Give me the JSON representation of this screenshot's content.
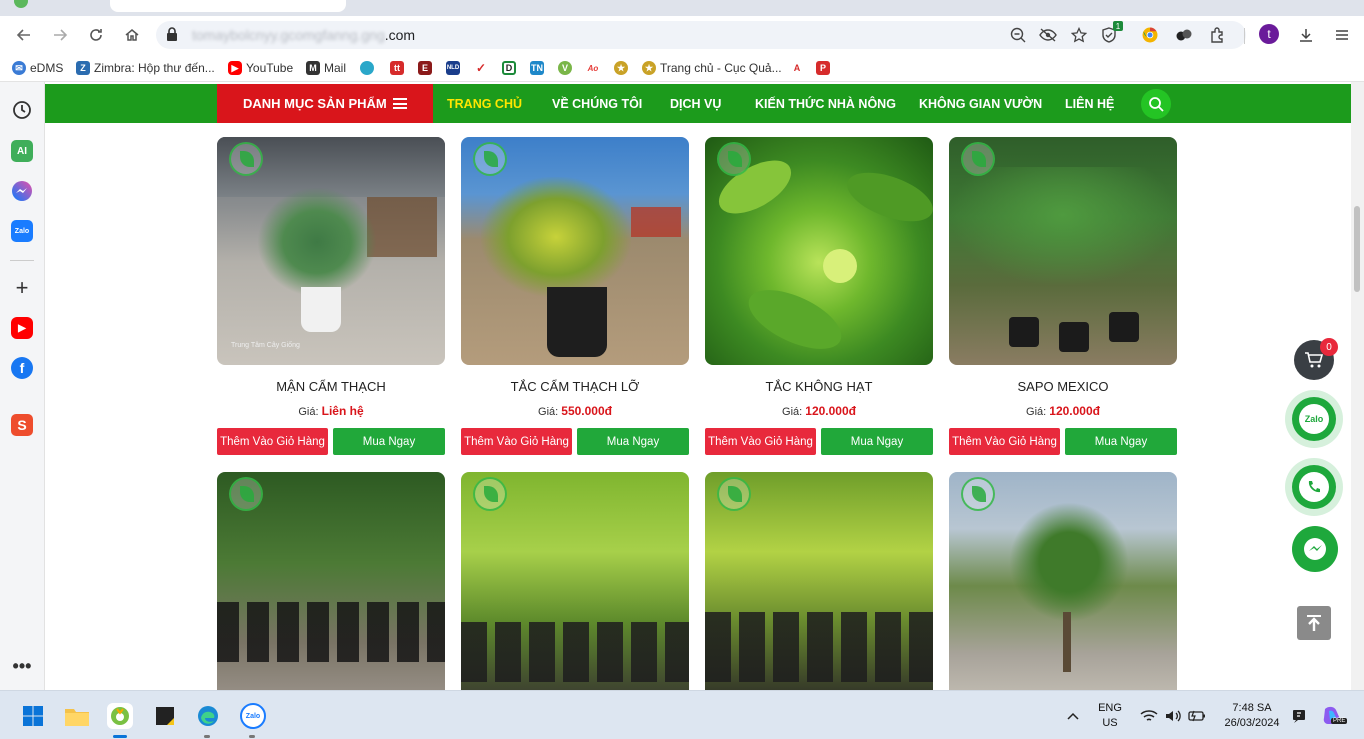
{
  "browser": {
    "url_host": "tomaybolcnyy.gcomgfanng.gng",
    "url_suffix": ".com",
    "extension_badge": "1",
    "profile_initial": "t"
  },
  "bookmarks": [
    {
      "label": "eDMS",
      "icon": "edms-icon",
      "color": "#3a7bd5"
    },
    {
      "label": "Zimbra: Hộp thư đến...",
      "icon": "zimbra-icon",
      "color": "#2b6cb0"
    },
    {
      "label": "YouTube",
      "icon": "youtube-icon",
      "color": "#ff0000"
    },
    {
      "label": "Mail",
      "icon": "mail-icon",
      "color": "#333333"
    },
    {
      "label": "",
      "icon": "bookmark-globe-icon",
      "color": "#2aa7c9"
    },
    {
      "label": "",
      "icon": "bookmark-tt-icon",
      "color": "#d62b2b"
    },
    {
      "label": "",
      "icon": "bookmark-e-icon",
      "color": "#8b1a1a"
    },
    {
      "label": "",
      "icon": "bookmark-nld-icon",
      "color": "#1a3d8b"
    },
    {
      "label": "",
      "icon": "bookmark-check-icon",
      "color": "#d62b2b"
    },
    {
      "label": "",
      "icon": "bookmark-d-icon",
      "color": "#222222"
    },
    {
      "label": "",
      "icon": "bookmark-tn-icon",
      "color": "#1e88c9"
    },
    {
      "label": "",
      "icon": "bookmark-v-icon",
      "color": "#7ab648"
    },
    {
      "label": "",
      "icon": "bookmark-ao-icon",
      "color": "#e53935"
    },
    {
      "label": "",
      "icon": "bookmark-emblem-icon",
      "color": "#c9a227"
    },
    {
      "label": "Trang chủ - Cục Quả...",
      "icon": "emblem-icon",
      "color": "#c9a227"
    },
    {
      "label": "",
      "icon": "bookmark-a-icon",
      "color": "#d62b2b"
    },
    {
      "label": "",
      "icon": "bookmark-p-icon",
      "color": "#d62b2b"
    }
  ],
  "site_nav": {
    "category_menu": "DANH MỤC SẢN PHẨM",
    "items": [
      "TRANG CHỦ",
      "VỀ CHÚNG TÔI",
      "DỊCH VỤ",
      "KIẾN THỨC NHÀ NÔNG",
      "KHÔNG GIAN VƯỜN",
      "LIÊN HỆ"
    ],
    "active_item": "TRANG CHỦ"
  },
  "products_row1": [
    {
      "name": "MẬN CẨM THẠCH",
      "price_label": "Giá:",
      "price": "Liên hệ",
      "watermark": "Trung Tâm Cây Giống",
      "add_to_cart": "Thêm Vào Giỏ Hàng",
      "buy_now": "Mua Ngay"
    },
    {
      "name": "TẮC CẨM THẠCH LỠ",
      "price_label": "Giá:",
      "price": "550.000đ",
      "add_to_cart": "Thêm Vào Giỏ Hàng",
      "buy_now": "Mua Ngay"
    },
    {
      "name": "TẮC KHÔNG HẠT",
      "price_label": "Giá:",
      "price": "120.000đ",
      "add_to_cart": "Thêm Vào Giỏ Hàng",
      "buy_now": "Mua Ngay"
    },
    {
      "name": "SAPO MEXICO",
      "price_label": "Giá:",
      "price": "120.000đ",
      "add_to_cart": "Thêm Vào Giỏ Hàng",
      "buy_now": "Mua Ngay"
    }
  ],
  "cart": {
    "count": "0"
  },
  "floating": {
    "zalo_label": "Zalo"
  },
  "taskbar": {
    "lang_top": "ENG",
    "lang_bottom": "US",
    "time": "7:48 SA",
    "date": "26/03/2024",
    "zalo_label": "Zalo",
    "copilot_badge": "PRE"
  },
  "sidebar": {
    "ai_label": "AI",
    "zalo_label": "Zalo"
  }
}
